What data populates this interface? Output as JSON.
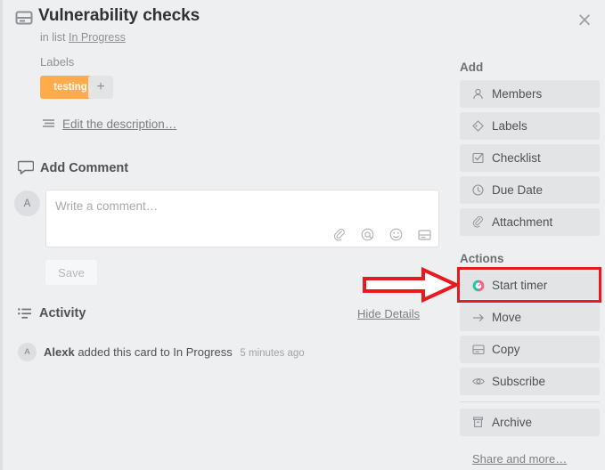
{
  "window": {
    "close_label": "×"
  },
  "card": {
    "icon": "card-icon",
    "title": "Vulnerability checks",
    "in_list_prefix": "in list",
    "list_name": "In Progress",
    "labels_heading": "Labels",
    "label_chip": "testing",
    "label_chip_color": "#ffab4a",
    "label_add": "+",
    "description_link": "Edit the description…"
  },
  "comment": {
    "heading": "Add Comment",
    "avatar_initial": "A",
    "placeholder": "Write a comment…",
    "save_label": "Save",
    "tools": [
      {
        "name": "attachment-icon"
      },
      {
        "name": "mention-icon"
      },
      {
        "name": "emoji-icon"
      },
      {
        "name": "card-icon"
      }
    ]
  },
  "activity": {
    "heading": "Activity",
    "hide_details": "Hide Details",
    "entries": [
      {
        "avatar_initial": "A",
        "user": "Alexk",
        "action": "added this card to In Progress",
        "time": "5 minutes ago"
      }
    ]
  },
  "sidebar": {
    "add_heading": "Add",
    "add_items": [
      {
        "label": "Members",
        "icon": "member-icon"
      },
      {
        "label": "Labels",
        "icon": "label-tag-icon"
      },
      {
        "label": "Checklist",
        "icon": "checklist-icon"
      },
      {
        "label": "Due Date",
        "icon": "clock-icon"
      },
      {
        "label": "Attachment",
        "icon": "paperclip-icon"
      }
    ],
    "actions_heading": "Actions",
    "action_items": [
      {
        "label": "Start timer",
        "icon": "timer-icon"
      },
      {
        "label": "Move",
        "icon": "arrow-right-icon"
      },
      {
        "label": "Copy",
        "icon": "copy-card-icon"
      },
      {
        "label": "Subscribe",
        "icon": "eye-icon"
      },
      {
        "label": "Archive",
        "icon": "archive-box-icon"
      }
    ],
    "share_link": "Share and more…"
  },
  "annotation": {
    "highlight_color": "#e8191f",
    "arrow_target": "Start timer"
  }
}
